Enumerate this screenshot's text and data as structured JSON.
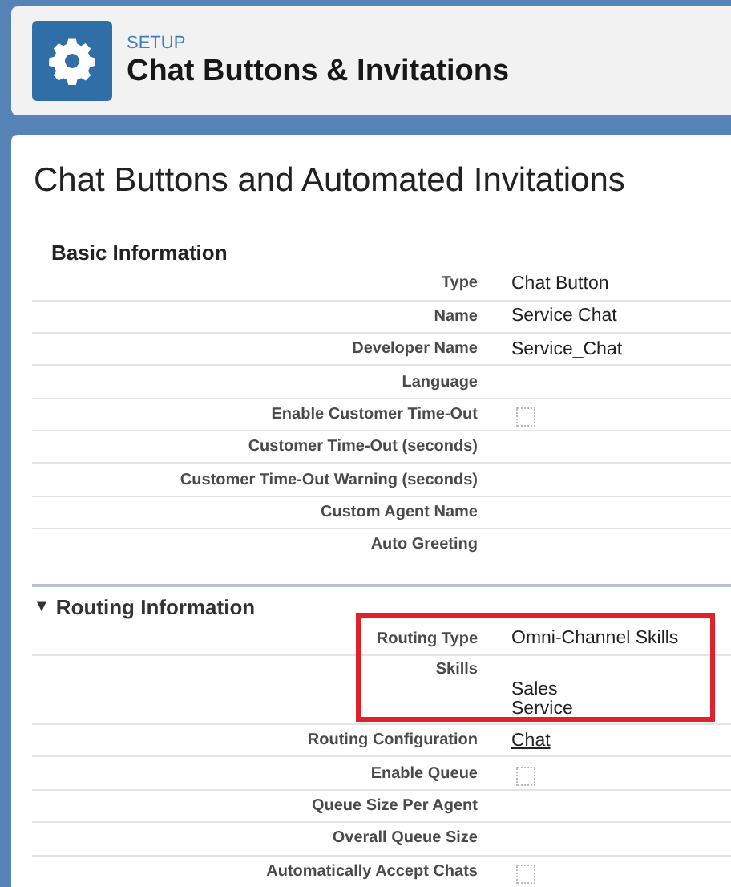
{
  "header": {
    "eyebrow": "SETUP",
    "title": "Chat Buttons & Invitations"
  },
  "page_title": "Chat Buttons and Automated Invitations",
  "sections": [
    {
      "title": "Basic Information",
      "rows": [
        {
          "label": "Type",
          "kind": "text",
          "value": "Chat Button",
          "highlighted": false
        },
        {
          "label": "Name",
          "kind": "text",
          "value": "Service Chat",
          "highlighted": false
        },
        {
          "label": "Developer Name",
          "kind": "text",
          "value": "Service_Chat",
          "highlighted": false
        },
        {
          "label": "Language",
          "kind": "text",
          "highlighted": false
        },
        {
          "label": "Enable Customer Time-Out",
          "kind": "checkbox",
          "checked": false,
          "highlighted": false
        },
        {
          "label": "Customer Time-Out (seconds)",
          "kind": "text",
          "highlighted": false
        },
        {
          "label": "Customer Time-Out Warning (seconds)",
          "kind": "text",
          "highlighted": false
        },
        {
          "label": "Custom Agent Name",
          "kind": "text",
          "highlighted": false
        },
        {
          "label": "Auto Greeting",
          "kind": "text",
          "highlighted": false
        }
      ]
    },
    {
      "title": "Routing Information",
      "toggle": "▼",
      "rows": [
        {
          "label": "Routing Type",
          "kind": "text",
          "value": "Omni-Channel Skills",
          "highlighted": true
        },
        {
          "label": "Skills",
          "kind": "list",
          "items": [
            "Sales",
            "Service"
          ],
          "highlighted": true
        },
        {
          "label": "Routing Configuration",
          "kind": "link",
          "value": "Chat",
          "highlighted": false
        },
        {
          "label": "Enable Queue",
          "kind": "checkbox",
          "checked": false,
          "highlighted": false
        },
        {
          "label": "Queue Size Per Agent",
          "kind": "text",
          "highlighted": false
        },
        {
          "label": "Overall Queue Size",
          "kind": "text",
          "highlighted": false
        },
        {
          "label": "Automatically Accept Chats",
          "kind": "checkbox",
          "checked": false,
          "highlighted": false
        }
      ]
    }
  ]
}
